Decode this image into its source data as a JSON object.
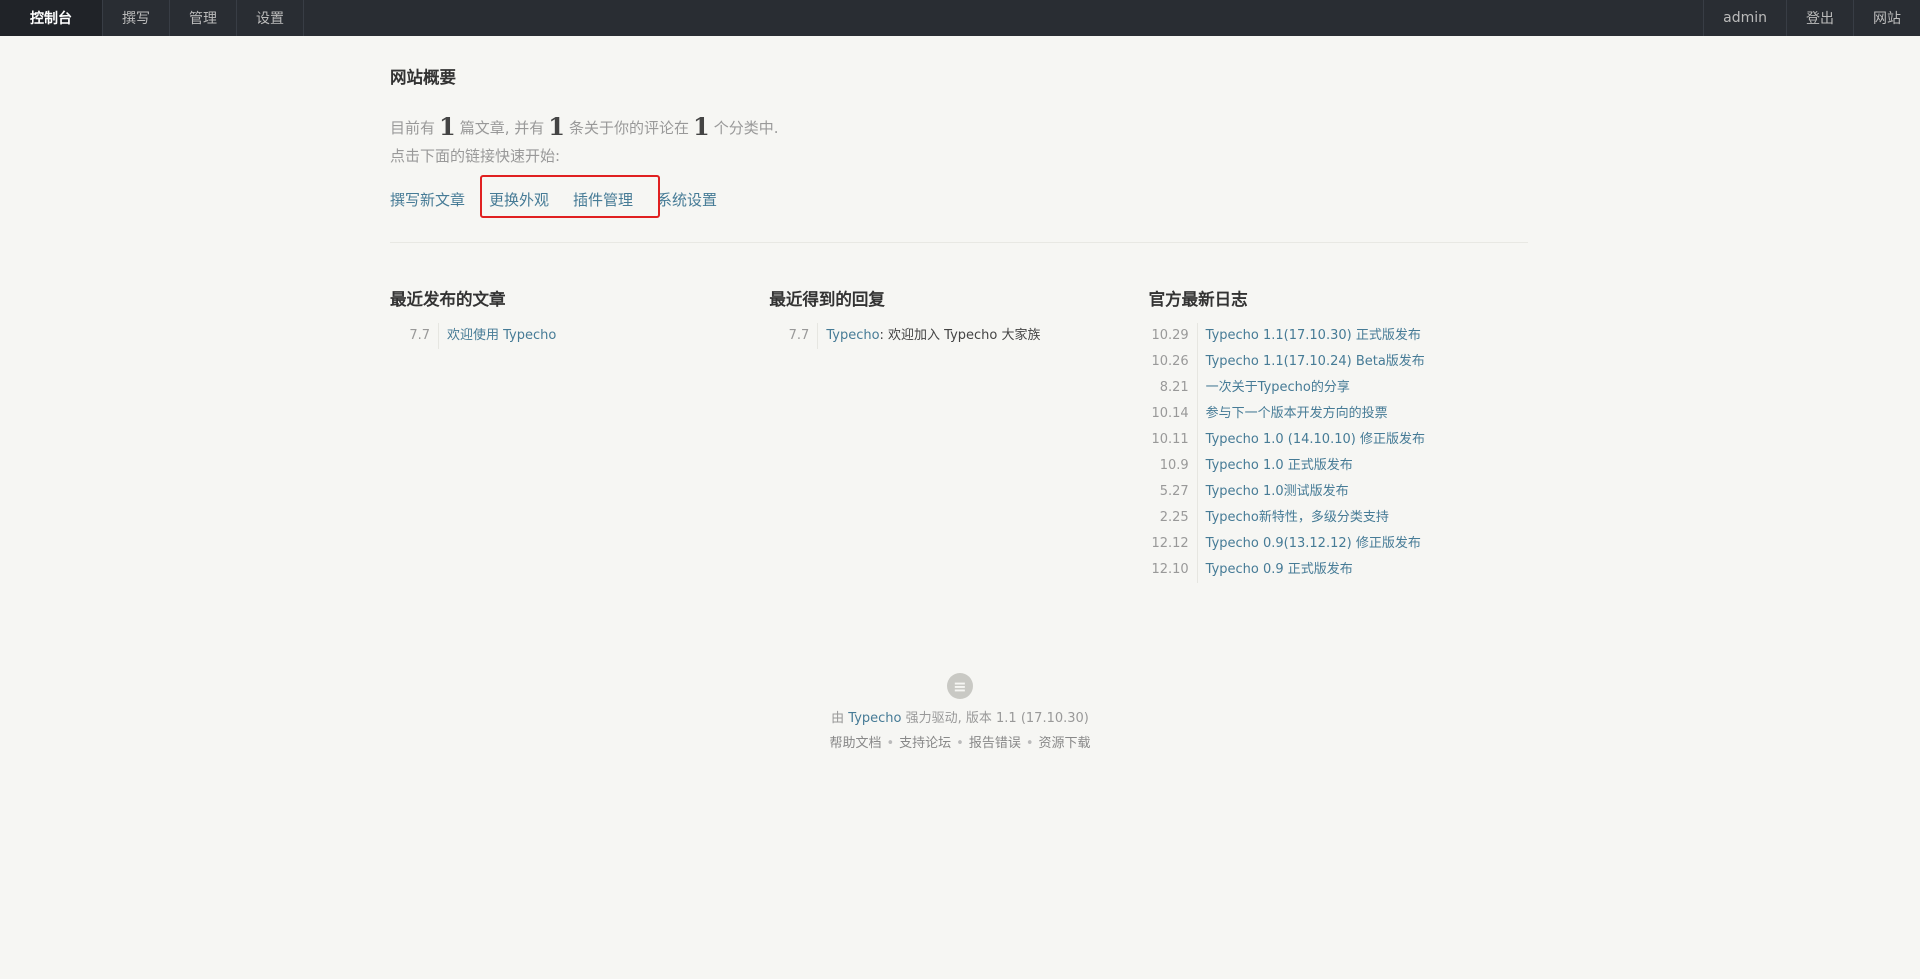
{
  "nav": {
    "left": [
      {
        "label": "控制台",
        "active": true
      },
      {
        "label": "撰写"
      },
      {
        "label": "管理"
      },
      {
        "label": "设置"
      }
    ],
    "right": [
      {
        "label": "admin"
      },
      {
        "label": "登出"
      },
      {
        "label": "网站"
      }
    ]
  },
  "overview": {
    "title": "网站概要",
    "text_prefix": "目前有",
    "posts_count": "1",
    "text_posts": "篇文章, 并有",
    "comments_count": "1",
    "text_comments": "条关于你的评论在",
    "categories_count": "1",
    "text_categories": "个分类中.",
    "hint": "点击下面的链接快速开始:",
    "quick_links": [
      "撰写新文章",
      "更换外观",
      "插件管理",
      "系统设置"
    ]
  },
  "recent_posts": {
    "title": "最近发布的文章",
    "items": [
      {
        "date": "7.7",
        "title": "欢迎使用 Typecho"
      }
    ]
  },
  "recent_replies": {
    "title": "最近得到的回复",
    "items": [
      {
        "date": "7.7",
        "author": "Typecho",
        "text": ": 欢迎加入 Typecho 大家族"
      }
    ]
  },
  "official_log": {
    "title": "官方最新日志",
    "items": [
      {
        "date": "10.29",
        "title": "Typecho 1.1(17.10.30) 正式版发布"
      },
      {
        "date": "10.26",
        "title": "Typecho 1.1(17.10.24) Beta版发布"
      },
      {
        "date": "8.21",
        "title": "一次关于Typecho的分享"
      },
      {
        "date": "10.14",
        "title": "参与下一个版本开发方向的投票"
      },
      {
        "date": "10.11",
        "title": "Typecho 1.0 (14.10.10) 修正版发布"
      },
      {
        "date": "10.9",
        "title": "Typecho 1.0 正式版发布"
      },
      {
        "date": "5.27",
        "title": "Typecho 1.0测试版发布"
      },
      {
        "date": "2.25",
        "title": "Typecho新特性，多级分类支持"
      },
      {
        "date": "12.12",
        "title": "Typecho 0.9(13.12.12) 修正版发布"
      },
      {
        "date": "12.10",
        "title": "Typecho 0.9 正式版发布"
      }
    ]
  },
  "footer": {
    "logo_icon": "≡",
    "powered_prefix": "由",
    "brand": "Typecho",
    "powered_suffix": "强力驱动, 版本 1.1 (17.10.30)",
    "links": [
      "帮助文档",
      "支持论坛",
      "报告错误",
      "资源下载"
    ],
    "separator": "•"
  },
  "colors": {
    "nav_bg": "#292d33",
    "link": "#467b96",
    "highlight": "#e02020",
    "page_bg": "#f6f6f3"
  }
}
